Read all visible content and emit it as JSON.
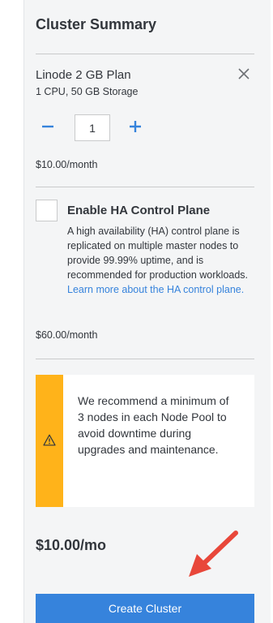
{
  "summary": {
    "title": "Cluster Summary"
  },
  "plan": {
    "name": "Linode 2 GB Plan",
    "specs": "1 CPU, 50 GB Storage",
    "quantity": "1",
    "price": "$10.00/month",
    "remove_icon": "close-icon",
    "minus_icon": "minus-icon",
    "plus_icon": "plus-icon"
  },
  "ha": {
    "checked": false,
    "title": "Enable HA Control Plane",
    "description": "A high availability (HA) control plane is replicated on multiple master nodes to provide 99.99% uptime, and is recommended for production workloads.",
    "link_text": "Learn more about the HA control plane.",
    "price": "$60.00/month"
  },
  "notice": {
    "icon": "warning-icon",
    "text": "We recommend a minimum of 3 nodes in each Node Pool to avoid downtime during upgrades and maintenance."
  },
  "total": {
    "price": "$10.00/mo"
  },
  "actions": {
    "create_label": "Create Cluster"
  },
  "colors": {
    "accent": "#3683dc",
    "warning": "#ffb31a",
    "annotation_arrow": "#e8473a",
    "panel_bg": "#f4f5f6"
  }
}
